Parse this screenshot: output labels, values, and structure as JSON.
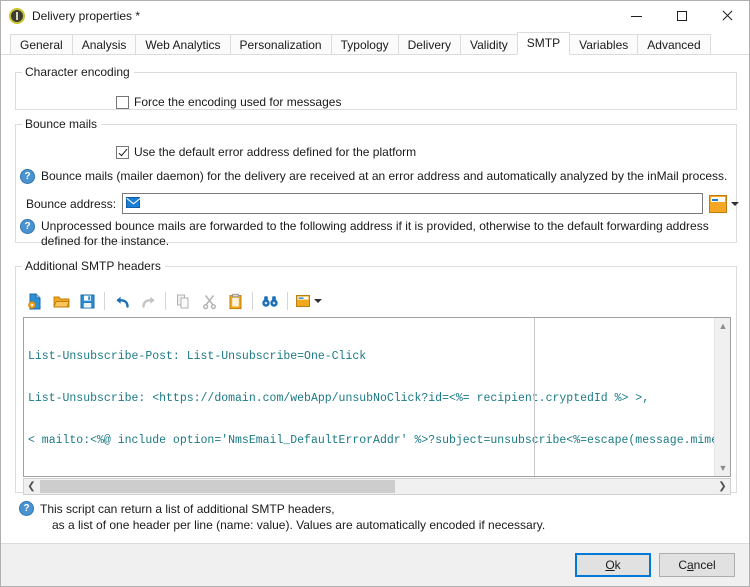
{
  "window": {
    "title": "Delivery properties *",
    "app_icon": "delivery-properties-icon",
    "minimize_label": "Minimize",
    "maximize_label": "Maximize",
    "close_label": "Close"
  },
  "tabs": [
    {
      "label": "General",
      "active": false
    },
    {
      "label": "Analysis",
      "active": false
    },
    {
      "label": "Web Analytics",
      "active": false
    },
    {
      "label": "Personalization",
      "active": false
    },
    {
      "label": "Typology",
      "active": false
    },
    {
      "label": "Delivery",
      "active": false
    },
    {
      "label": "Validity",
      "active": false
    },
    {
      "label": "SMTP",
      "active": true
    },
    {
      "label": "Variables",
      "active": false
    },
    {
      "label": "Advanced",
      "active": false
    }
  ],
  "character_encoding": {
    "legend": "Character encoding",
    "force_encoding": {
      "label": "Force the encoding used for messages",
      "checked": false
    }
  },
  "bounce_mails": {
    "legend": "Bounce mails",
    "use_default_error_address": {
      "label": "Use the default error address defined for the platform",
      "checked": true
    },
    "info": "Bounce mails (mailer daemon) for the delivery are received at an error address and automatically analyzed by the inMail process.",
    "address_label": "Bounce address:",
    "address_value": "",
    "address_placeholder": "",
    "address_icon": "envelope-icon",
    "picker_icon": "expression-picker-icon",
    "note": "Unprocessed bounce mails are forwarded to the following address if it is provided, otherwise to the default forwarding address defined for the instance."
  },
  "additional_headers": {
    "legend": "Additional SMTP headers",
    "toolbar": [
      {
        "name": "new-script-icon",
        "title": "New",
        "enabled": true
      },
      {
        "name": "open-folder-icon",
        "title": "Open",
        "enabled": true
      },
      {
        "name": "save-icon",
        "title": "Save",
        "enabled": true
      },
      {
        "name": "undo-icon",
        "title": "Undo",
        "enabled": true
      },
      {
        "name": "redo-icon",
        "title": "Redo",
        "enabled": false
      },
      {
        "name": "copy-icon",
        "title": "Copy",
        "enabled": false
      },
      {
        "name": "cut-icon",
        "title": "Cut",
        "enabled": false
      },
      {
        "name": "paste-icon",
        "title": "Paste",
        "enabled": true
      },
      {
        "name": "find-icon",
        "title": "Find",
        "enabled": true
      },
      {
        "name": "insert-field-icon",
        "title": "Insert",
        "enabled": true
      }
    ],
    "code_lines": [
      "List-Unsubscribe-Post: List-Unsubscribe=One-Click",
      "List-Unsubscribe: <https://domain.com/webApp/unsubNoClick?id=<%= recipient.cryptedId %> >,",
      "< mailto:<%@ include option='NmsEmail_DefaultErrorAddr' %>?subject=unsubscribe<%=escape(message.mimeMessag"
    ],
    "code_color": "#1b7a85",
    "scroll_up_icon": "chevron-up-icon",
    "scroll_down_icon": "chevron-down-icon",
    "scroll_left_icon": "chevron-left-icon",
    "scroll_right_icon": "chevron-right-icon"
  },
  "footer_help": {
    "line1": "This script can return a list of additional SMTP headers,",
    "line2": "as a list of one header per line (name: value). Values are automatically encoded if necessary."
  },
  "buttons": {
    "ok_prefix": "",
    "ok_accel": "O",
    "ok_suffix": "k",
    "cancel_prefix": "C",
    "cancel_accel": "a",
    "cancel_suffix": "ncel",
    "ok_label": "Ok",
    "cancel_label": "Cancel"
  },
  "colors": {
    "accent": "#0078d7",
    "help_icon": "#4a93d1",
    "code_text": "#1b7a85",
    "group_border": "#dcdcdc"
  }
}
